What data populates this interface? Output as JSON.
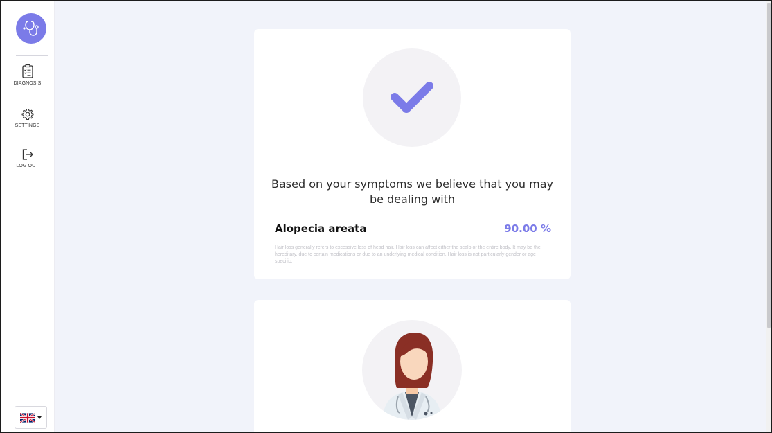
{
  "sidebar": {
    "items": [
      {
        "label": "DIAGNOSIS",
        "icon": "clipboard-checklist-icon"
      },
      {
        "label": "SETTINGS",
        "icon": "gear-icon"
      },
      {
        "label": "LOG OUT",
        "icon": "logout-icon"
      }
    ],
    "language": {
      "icon": "uk-flag-icon"
    }
  },
  "result": {
    "heading": "Based on your symptoms we believe that you may be dealing with",
    "disease": "Alopecia areata",
    "probability": "90.00 %",
    "description": "Hair loss generally refers to excessive loss of head hair. Hair loss can affect either the scalp or the entire body. It may be the hereditary, due to certain medications or due to an underlying medical condition. Hair loss is not particularly gender or age specific."
  },
  "colors": {
    "accent": "#7b7be8",
    "background": "#f1f3fa"
  }
}
